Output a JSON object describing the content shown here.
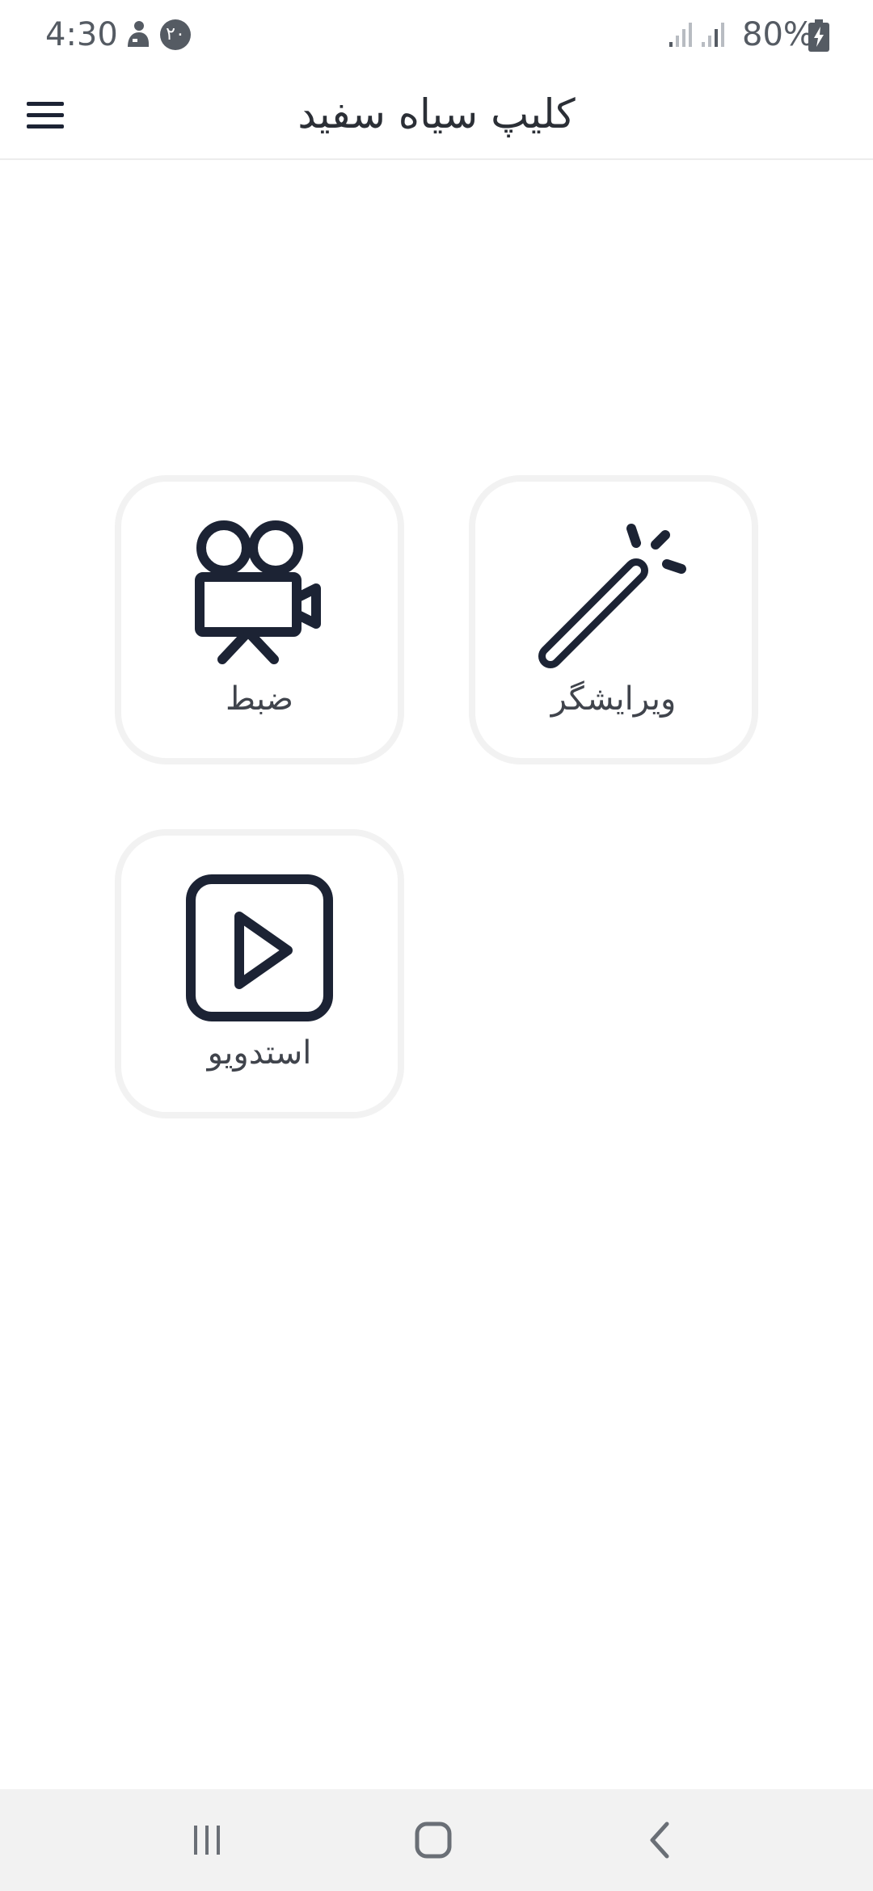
{
  "status_bar": {
    "time": "4:30",
    "badge": "۲۰",
    "battery": "80%"
  },
  "app_bar": {
    "title": "کلیپ سیاه سفید"
  },
  "tiles": [
    {
      "label": "ویرایشگر",
      "icon": "magic-wand-icon"
    },
    {
      "label": "ضبط",
      "icon": "movie-camera-icon"
    },
    {
      "label": "استدویو",
      "icon": "play-square-icon"
    }
  ],
  "colors": {
    "icon": "#1c2334",
    "text": "#40444c",
    "tile_border": "#f2f2f2",
    "nav_bar": "#f2f2f2"
  }
}
